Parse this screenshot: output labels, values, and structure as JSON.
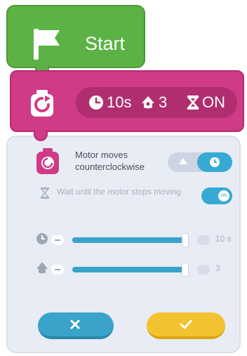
{
  "start_block": {
    "label": "Start"
  },
  "motor_block": {
    "duration": "10s",
    "speed": "3",
    "wait": "ON"
  },
  "panel": {
    "motor_label": "Motor moves counterclockwise",
    "wait_label": "Wait until the motor stops moving",
    "wait_switch": "ON",
    "duration_slider": {
      "value_text": "10 s",
      "fill_fraction": 0.97
    },
    "speed_slider": {
      "value_text": "3",
      "fill_fraction": 0.97
    }
  },
  "colors": {
    "start": "#5cb245",
    "motor": "#cf3b86",
    "accent_blue": "#37a9d5",
    "confirm_yellow": "#f2c230"
  },
  "icons": [
    "flag-icon",
    "motor-rotate-icon",
    "clock-icon",
    "speed-icon",
    "hourglass-icon",
    "check-icon",
    "close-icon",
    "minus-icon",
    "plus-icon"
  ]
}
